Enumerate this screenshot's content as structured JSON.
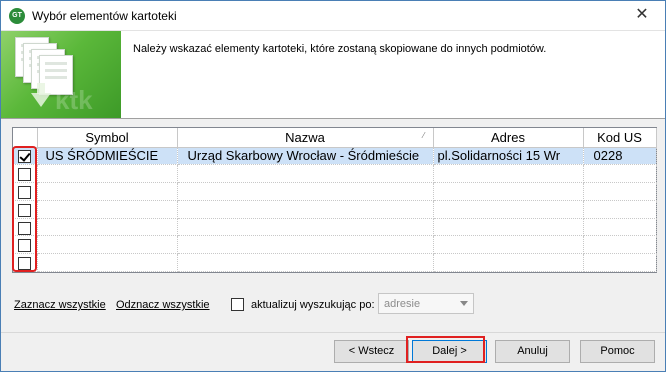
{
  "window": {
    "title": "Wybór elementów kartoteki",
    "close_glyph": "✕",
    "icon_text": "GT"
  },
  "header": {
    "instruction": "Należy wskazać elementy kartoteki, które zostaną skopiowane do innych podmiotów.",
    "banner_watermark": "ktk"
  },
  "grid": {
    "columns": [
      "",
      "Symbol",
      "Nazwa",
      "Adres",
      "Kod US"
    ],
    "sorted_column_indicator": "⁄",
    "rows": [
      {
        "checked": true,
        "symbol": "US ŚRÓDMIEŚCIE",
        "nazwa": "Urząd Skarbowy Wrocław - Śródmieście",
        "adres": "pl.Solidarności 15 Wr",
        "kod": "0228"
      },
      {
        "checked": false,
        "symbol": "",
        "nazwa": "",
        "adres": "",
        "kod": ""
      },
      {
        "checked": false,
        "symbol": "",
        "nazwa": "",
        "adres": "",
        "kod": ""
      },
      {
        "checked": false,
        "symbol": "",
        "nazwa": "",
        "adres": "",
        "kod": ""
      },
      {
        "checked": false,
        "symbol": "",
        "nazwa": "",
        "adres": "",
        "kod": ""
      },
      {
        "checked": false,
        "symbol": "",
        "nazwa": "",
        "adres": "",
        "kod": ""
      },
      {
        "checked": false,
        "symbol": "",
        "nazwa": "",
        "adres": "",
        "kod": ""
      }
    ]
  },
  "controls": {
    "select_all": "Zaznacz wszystkie",
    "deselect_all": "Odznacz wszystkie",
    "update_label": "aktualizuj wyszukując po:",
    "search_by_value": "adresie"
  },
  "buttons": {
    "back": "< Wstecz",
    "next": "Dalej >",
    "cancel": "Anuluj",
    "help": "Pomoc"
  },
  "colors": {
    "selected_row": "#cde1f7",
    "highlight_red": "#e02020",
    "banner_green": "#5bb83a"
  }
}
